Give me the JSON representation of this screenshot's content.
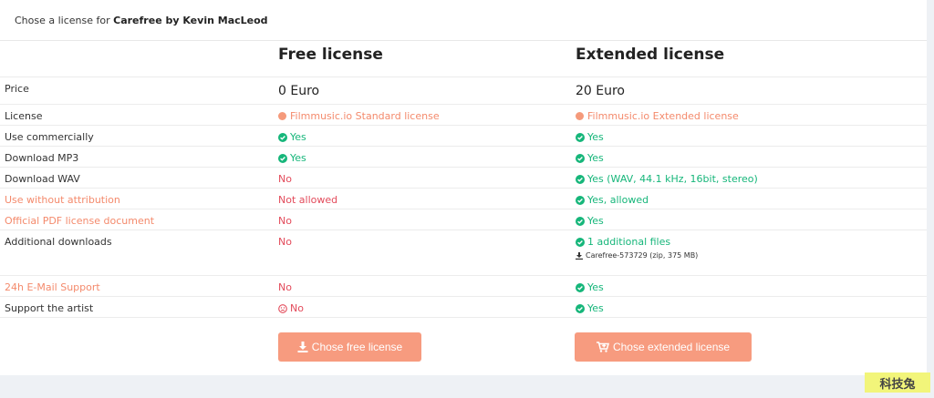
{
  "header": {
    "prefix": "Chose a license for ",
    "track": "Carefree by Kevin MacLeod"
  },
  "columns": {
    "free": "Free license",
    "extended": "Extended license"
  },
  "price": {
    "label": "Price",
    "free": "0 Euro",
    "extended": "20 Euro"
  },
  "license": {
    "label": "License",
    "free": "Filmmusic.io Standard license",
    "extended": "Filmmusic.io Extended license"
  },
  "commercial": {
    "label": "Use commercially",
    "free": "Yes",
    "extended": "Yes"
  },
  "mp3": {
    "label": "Download MP3",
    "free": "Yes",
    "extended": "Yes"
  },
  "wav": {
    "label": "Download WAV",
    "free": "No",
    "extended": "Yes (WAV, 44.1 kHz, 16bit, stereo)"
  },
  "attribution": {
    "label": "Use without attribution",
    "free": "Not allowed",
    "extended": "Yes, allowed"
  },
  "pdf": {
    "label": "Official PDF license document",
    "free": "No",
    "extended": "Yes"
  },
  "additional": {
    "label": "Additional downloads",
    "free": "No",
    "extended": "1 additional files",
    "file": "Carefree-573729 (zip, 375 MB)"
  },
  "support": {
    "label": "24h E-Mail Support",
    "free": "No",
    "extended": "Yes"
  },
  "artist": {
    "label": "Support the artist",
    "free": "No",
    "extended": "Yes"
  },
  "buttons": {
    "free": "Chose free license",
    "extended": "Chose extended license"
  },
  "watermark": "科技兔",
  "colors": {
    "accent": "#f79b7f",
    "green": "#16b67a",
    "red": "#e34b5b"
  }
}
